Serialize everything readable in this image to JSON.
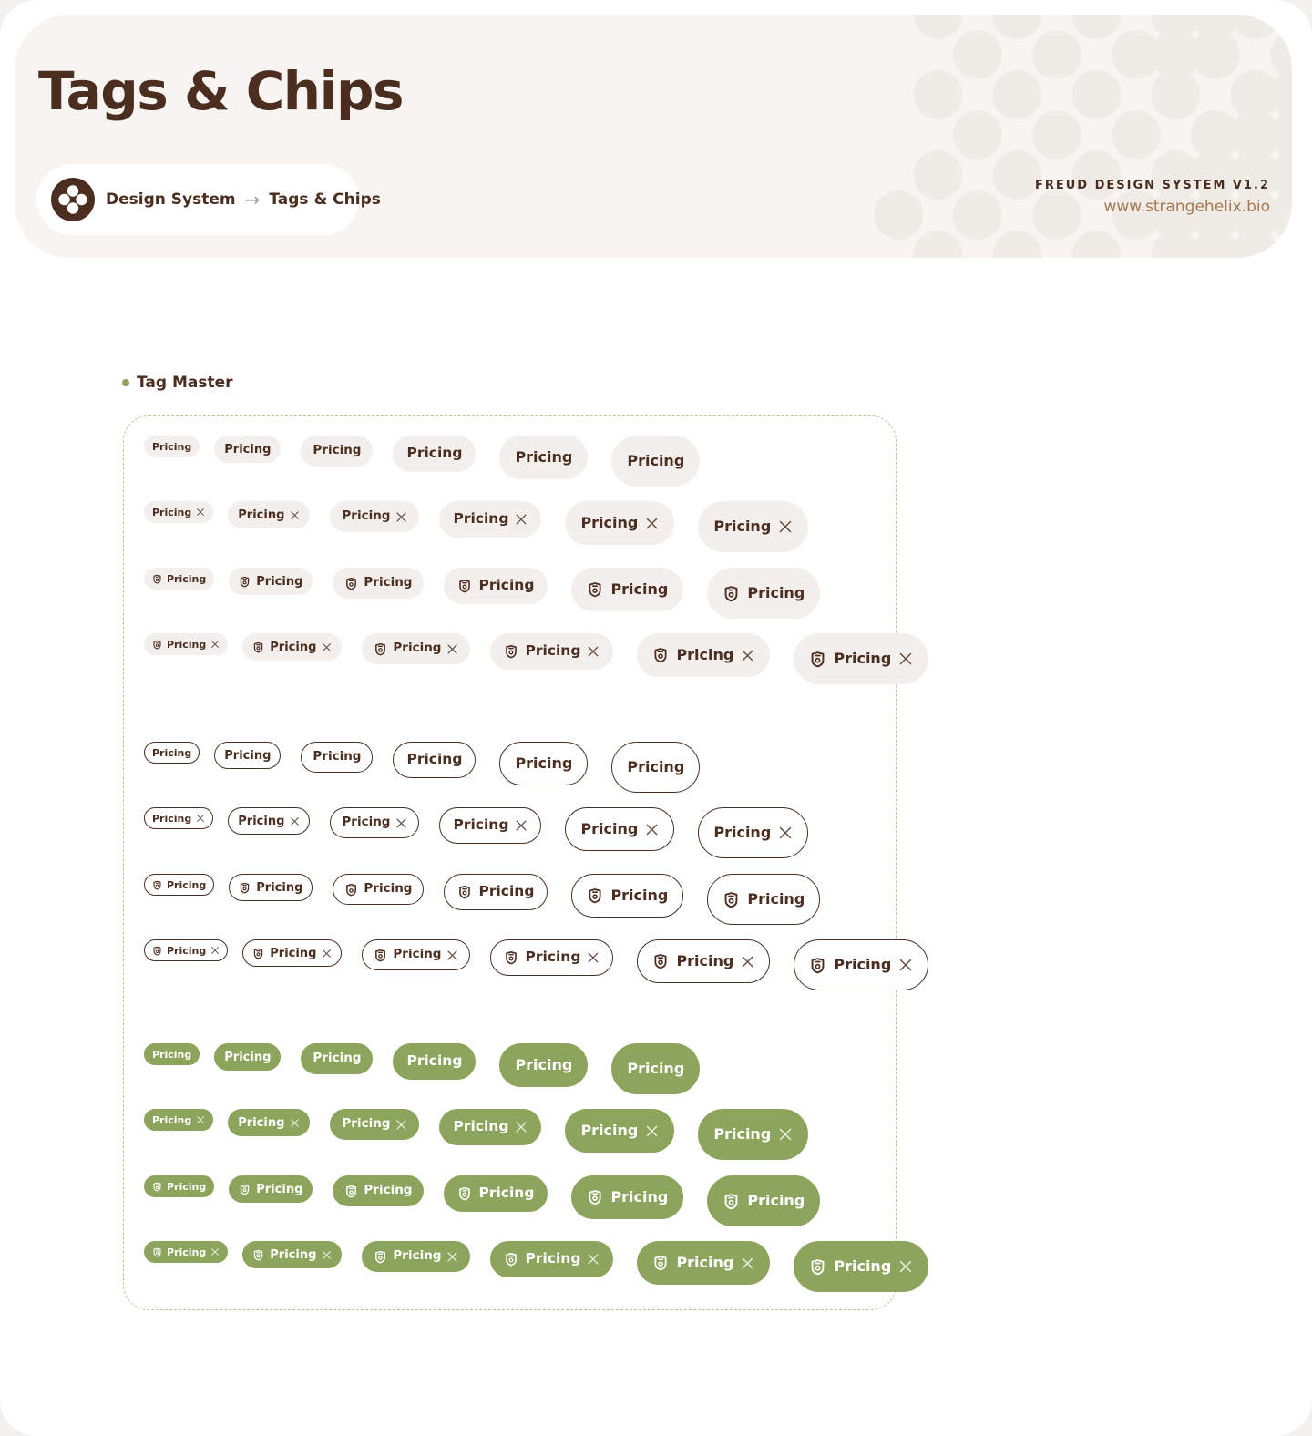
{
  "header": {
    "title": "Tags & Chips",
    "breadcrumb_root": "Design System",
    "breadcrumb_arrow": "→",
    "breadcrumb_current": "Tags & Chips",
    "version": "FREUD DESIGN SYSTEM V1.2",
    "url": "www.strangehelix.bio"
  },
  "section": {
    "label": "Tag Master"
  },
  "tag_label": "Pricing",
  "colors": {
    "brown": "#4b2e20",
    "soft_bg": "#f3efec",
    "green": "#8da45c",
    "hero_bg": "#f7f4f2",
    "url_accent": "#a4784f"
  },
  "icons": {
    "leading": "shield-icon",
    "trailing": "close-icon"
  },
  "variants": [
    "soft",
    "outline",
    "filled"
  ],
  "sizes": [
    "xs",
    "sm",
    "md",
    "lg",
    "xl",
    "2xl"
  ],
  "row_types": [
    "label-only",
    "label-with-close",
    "icon-with-label",
    "icon-label-close"
  ]
}
